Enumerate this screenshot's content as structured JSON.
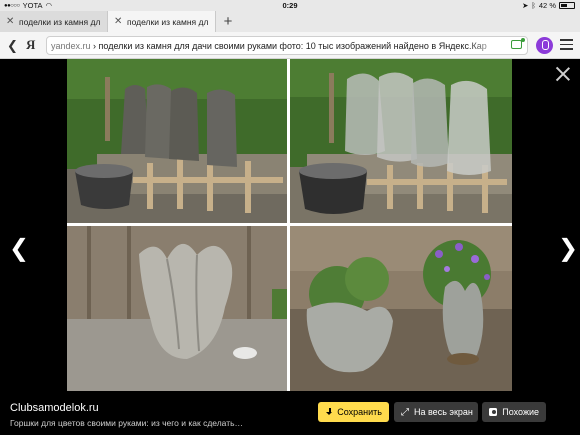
{
  "status": {
    "carrier": "YOTA",
    "time": "0:29",
    "battery": "42 %",
    "battery_level": 0.42
  },
  "tabs": [
    {
      "title": "поделки из камня дл"
    },
    {
      "title": "поделки из камня дл"
    }
  ],
  "address_bar": {
    "logo": "Я",
    "domain": "yandex.ru",
    "separator": " › ",
    "query": "поделки из камня для дачи своими руками фото: 10 тыс изображений найдено в Яндекс.Кар"
  },
  "viewer": {
    "source_title": "Clubsamodelok.ru",
    "source_description": "Горшки для цветов своими руками: из чего и как сделать…",
    "buttons": {
      "save": "Сохранить",
      "fullscreen": "На весь экран",
      "similar": "Похожие"
    }
  },
  "colors": {
    "save_button": "#ffdb4d",
    "alice": "#8c3bd9",
    "hedge": "#3f6b2a"
  }
}
